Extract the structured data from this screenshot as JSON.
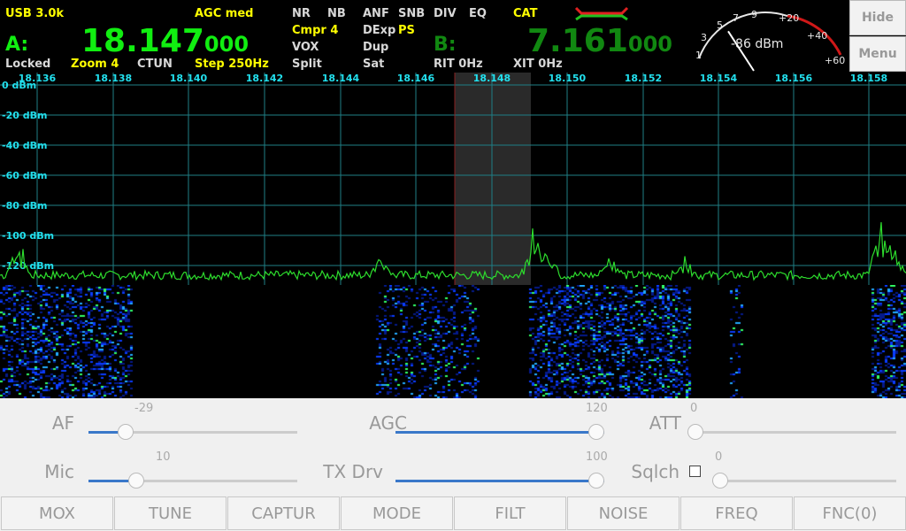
{
  "vfoA": {
    "mode": "USB 3.0k",
    "agc": "AGC med",
    "label": "A:",
    "freq_main": "18.147",
    "freq_sub": "000",
    "locked": "Locked",
    "zoom": "Zoom 4",
    "ctun": "CTUN",
    "step": "Step 250Hz"
  },
  "dsp": {
    "nr": "NR",
    "nb": "NB",
    "anf": "ANF",
    "snb": "SNB",
    "div": "DIV",
    "eq": "EQ",
    "cat": "CAT",
    "cmpr": "Cmpr 4",
    "dexp": "DExp",
    "ps": "PS",
    "vox": "VOX",
    "dup": "Dup",
    "split": "Split",
    "sat": "Sat"
  },
  "vfoB": {
    "label": "B:",
    "freq_main": "7.161",
    "freq_sub": "000",
    "rit": "RIT 0Hz",
    "xit": "XIT 0Hz"
  },
  "meter": {
    "reading": "-86 dBm",
    "ticks": [
      "1",
      "3",
      "5",
      "7",
      "9",
      "+20",
      "+40",
      "+60"
    ],
    "level_fraction": 0.42
  },
  "side": {
    "hide": "Hide",
    "menu": "Menu"
  },
  "panadapter": {
    "freq_labels": [
      "18.136",
      "18.138",
      "18.140",
      "18.142",
      "18.144",
      "18.146",
      "18.148",
      "18.150",
      "18.152",
      "18.154",
      "18.156",
      "18.158"
    ],
    "db_labels": [
      "0 dBm",
      "-20 dBm",
      "-40 dBm",
      "-60 dBm",
      "-80 dBm",
      "-100 dBm",
      "-120 dBm"
    ],
    "colors": {
      "grid": "#1f7f86",
      "trace": "#2ddc2d",
      "label": "#22e0ee"
    }
  },
  "controls": {
    "af": {
      "label": "AF",
      "value": "-29",
      "level": 0.18
    },
    "agc": {
      "label": "AGC",
      "value": "120",
      "level": 1.0
    },
    "att": {
      "label": "ATT",
      "value": "0",
      "level": 0.0
    },
    "mic": {
      "label": "Mic",
      "value": "10",
      "level": 0.23
    },
    "txdrv": {
      "label": "TX Drv",
      "value": "100",
      "level": 1.0
    },
    "sqlch": {
      "label": "Sqlch",
      "value": "0",
      "level": 0.0
    }
  },
  "buttons": [
    "MOX",
    "TUNE",
    "CAPTUR",
    "MODE",
    "FILT",
    "NOISE",
    "FREQ",
    "FNC(0)"
  ]
}
